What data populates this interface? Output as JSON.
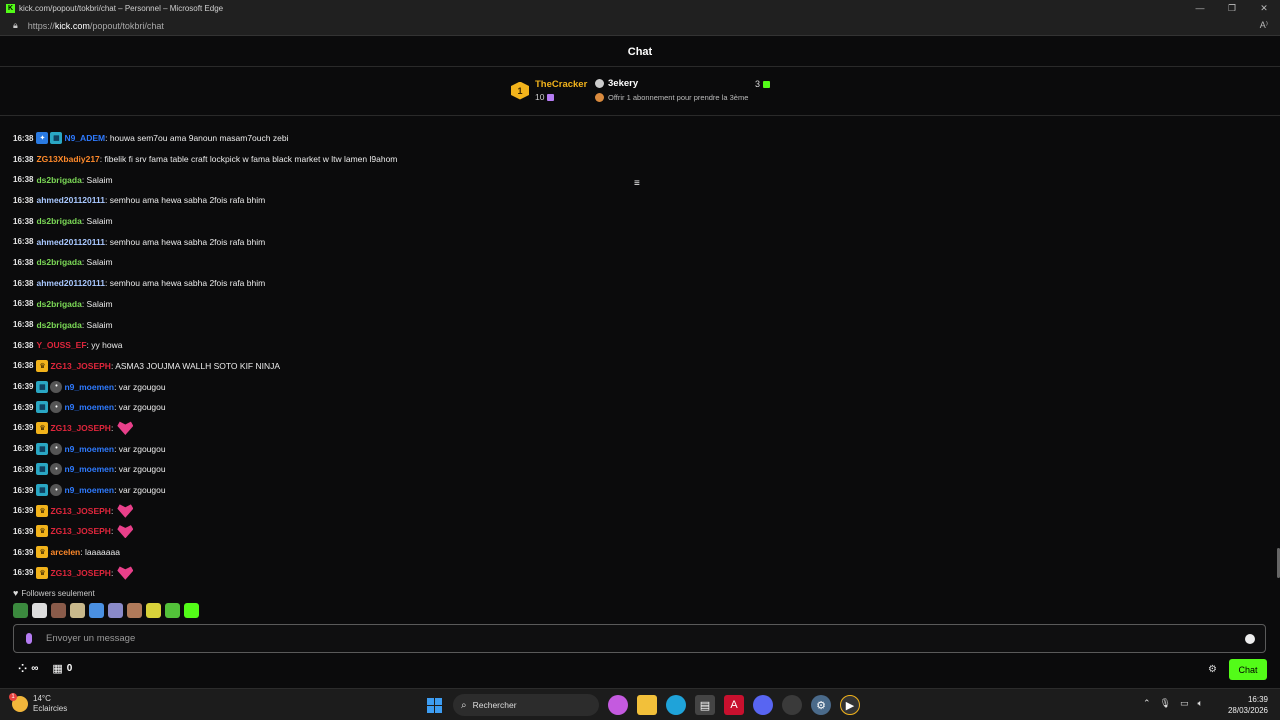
{
  "window": {
    "title": "kick.com/popout/tokbri/chat – Personnel – Microsoft Edge",
    "url_prefix": "https://",
    "url_host": "kick.com",
    "url_path": "/popout/tokbri/chat"
  },
  "chat": {
    "title": "Chat",
    "pinned": {
      "top_gifter_rank": "1",
      "top_gifter_name": "TheCracker",
      "top_gifter_count": "10",
      "goal_user": "3ekery",
      "goal_count": "3",
      "goal_text": "Offrir 1 abonnement pour prendre la 3ème"
    },
    "messages": [
      {
        "time": "16:38",
        "badges": [
          "star",
          "sub"
        ],
        "user": "N9_ADEM",
        "color": "#2f7bff",
        "text": ": houwa sem7ou ama 9anoun masam7ouch zebi",
        "emote": false
      },
      {
        "time": "16:38",
        "badges": [],
        "user": "ZG13Xbadiy217",
        "color": "#ff8a2b",
        "text": ": fibelik fi srv fama table craft lockpick w fama black market w ltw lamen l9ahom",
        "emote": false
      },
      {
        "time": "16:38",
        "badges": [],
        "user": "ds2brigada",
        "color": "#7cd957",
        "text": ": Salaim",
        "emote": false
      },
      {
        "time": "16:38",
        "badges": [],
        "user": "ahmed201120111",
        "color": "#a9c8ff",
        "text": ": semhou ama hewa sabha 2fois rafa bhim",
        "emote": false
      },
      {
        "time": "16:38",
        "badges": [],
        "user": "ds2brigada",
        "color": "#7cd957",
        "text": ": Salaim",
        "emote": false
      },
      {
        "time": "16:38",
        "badges": [],
        "user": "ahmed201120111",
        "color": "#a9c8ff",
        "text": ": semhou ama hewa sabha 2fois rafa bhim",
        "emote": false
      },
      {
        "time": "16:38",
        "badges": [],
        "user": "ds2brigada",
        "color": "#7cd957",
        "text": ": Salaim",
        "emote": false
      },
      {
        "time": "16:38",
        "badges": [],
        "user": "ahmed201120111",
        "color": "#a9c8ff",
        "text": ": semhou ama hewa sabha 2fois rafa bhim",
        "emote": false
      },
      {
        "time": "16:38",
        "badges": [],
        "user": "ds2brigada",
        "color": "#7cd957",
        "text": ": Salaim",
        "emote": false
      },
      {
        "time": "16:38",
        "badges": [],
        "user": "ds2brigada",
        "color": "#7cd957",
        "text": ": Salaim",
        "emote": false
      },
      {
        "time": "16:38",
        "badges": [],
        "user": "Y_OUSS_EF",
        "color": "#e0263c",
        "text": ": yy howa",
        "emote": false
      },
      {
        "time": "16:38",
        "badges": [
          "crown"
        ],
        "user": "ZG13_JOSEPH",
        "color": "#e0263c",
        "text": ": ASMA3 JOUJMA WALLH SOTO KIF NINJA",
        "emote": false
      },
      {
        "time": "16:39",
        "badges": [
          "sub",
          "avatar"
        ],
        "user": "n9_moemen",
        "color": "#2f7bff",
        "text": ": var zgougou",
        "emote": false
      },
      {
        "time": "16:39",
        "badges": [
          "sub",
          "avatar"
        ],
        "user": "n9_moemen",
        "color": "#2f7bff",
        "text": ": var zgougou",
        "emote": false
      },
      {
        "time": "16:39",
        "badges": [
          "crown"
        ],
        "user": "ZG13_JOSEPH",
        "color": "#e0263c",
        "text": ":",
        "emote": true
      },
      {
        "time": "16:39",
        "badges": [
          "sub",
          "avatar"
        ],
        "user": "n9_moemen",
        "color": "#2f7bff",
        "text": ": var zgougou",
        "emote": false
      },
      {
        "time": "16:39",
        "badges": [
          "sub",
          "avatar"
        ],
        "user": "n9_moemen",
        "color": "#2f7bff",
        "text": ": var zgougou",
        "emote": false
      },
      {
        "time": "16:39",
        "badges": [
          "sub",
          "avatar"
        ],
        "user": "n9_moemen",
        "color": "#2f7bff",
        "text": ": var zgougou",
        "emote": false
      },
      {
        "time": "16:39",
        "badges": [
          "crown"
        ],
        "user": "ZG13_JOSEPH",
        "color": "#e0263c",
        "text": ":",
        "emote": true
      },
      {
        "time": "16:39",
        "badges": [
          "crown"
        ],
        "user": "ZG13_JOSEPH",
        "color": "#e0263c",
        "text": ":",
        "emote": true
      },
      {
        "time": "16:39",
        "badges": [
          "crown"
        ],
        "user": "arcelen",
        "color": "#ff8a2b",
        "text": ": laaaaaaa",
        "emote": false
      },
      {
        "time": "16:39",
        "badges": [
          "crown"
        ],
        "user": "ZG13_JOSEPH",
        "color": "#e0263c",
        "text": ":",
        "emote": true
      }
    ],
    "followers_only": "Followers seulement",
    "emote_colors": [
      "#3b8a3e",
      "#dddddd",
      "#8a5b4a",
      "#c9b98c",
      "#4a90e2",
      "#8a8ac9",
      "#b07a5a",
      "#d8d23a",
      "#53c23a",
      "#53fc18"
    ],
    "input_placeholder": "Envoyer un message",
    "points_count": "0",
    "send_label": "Chat",
    "accent_color": "#53fc18"
  },
  "taskbar": {
    "temperature": "14°C",
    "weather": "Eclaircies",
    "weather_badge": "1",
    "search_label": "Rechercher",
    "time": "16:39",
    "date": "28/03/2026"
  }
}
